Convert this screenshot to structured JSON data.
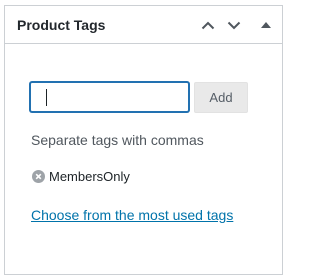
{
  "metabox": {
    "title": "Product Tags",
    "controls": {
      "move_up_icon": "chevron-up-icon",
      "move_down_icon": "chevron-down-icon",
      "toggle_icon": "triangle-up-icon"
    }
  },
  "tags": {
    "input_value": "",
    "add_label": "Add",
    "hint": "Separate tags with commas",
    "items": [
      {
        "label": "MembersOnly",
        "remove_icon": "remove-circle-icon"
      }
    ],
    "most_used_link": "Choose from the most used tags"
  },
  "colors": {
    "accent": "#2271b1",
    "link": "#0073aa",
    "border": "#ccd0d4",
    "button_bg": "#e9e9e9"
  }
}
